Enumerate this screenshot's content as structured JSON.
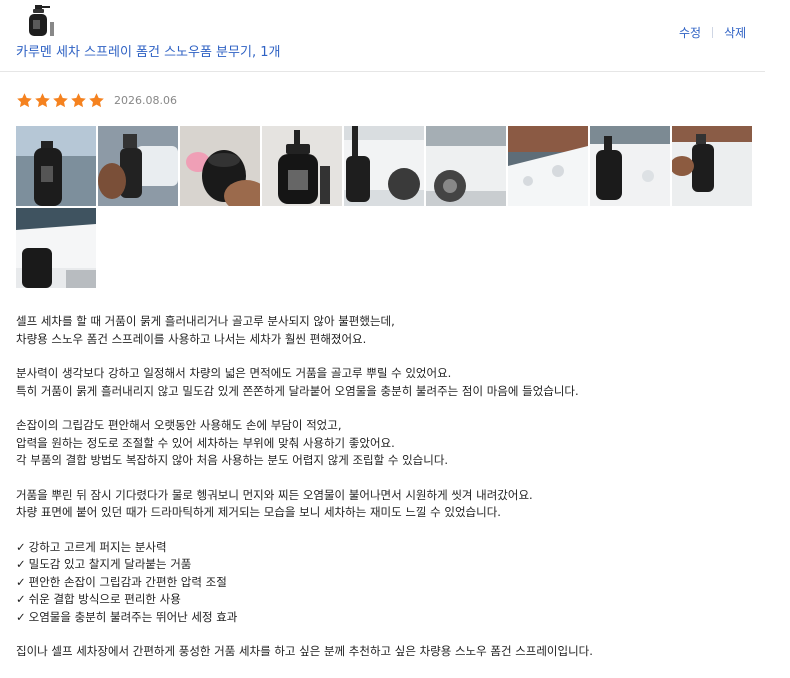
{
  "product": {
    "title": "카루멘 세차 스프레이 폼건 스노우폼 분무기, 1개",
    "thumbnail_icon": "foam-sprayer-bottle"
  },
  "actions": {
    "edit_label": "수정",
    "delete_label": "삭제"
  },
  "review": {
    "rating": 5,
    "max_rating": 5,
    "date": "2026.08.06",
    "photo_count": 10,
    "paragraphs": [
      {
        "lines": [
          "셀프 세차를 할 때 거품이 묽게 흘러내리거나 골고루 분사되지 않아 불편했는데,",
          "차량용 스노우 폼건 스프레이를 사용하고 나서는 세차가 훨씬 편해졌어요."
        ]
      },
      {
        "lines": [
          "분사력이 생각보다 강하고 일정해서 차량의 넓은 면적에도 거품을 골고루 뿌릴 수 있었어요.",
          "특히 거품이 묽게 흘러내리지 않고 밀도감 있게 쫀쫀하게 달라붙어 오염물을 충분히 불려주는 점이 마음에 들었습니다."
        ]
      },
      {
        "lines": [
          "손잡이의 그립감도 편안해서 오랫동안 사용해도 손에 부담이 적었고,",
          "압력을 원하는 정도로 조절할 수 있어 세차하는 부위에 맞춰 사용하기 좋았어요.",
          "각 부품의 결합 방법도 복잡하지 않아 처음 사용하는 분도 어렵지 않게 조립할 수 있습니다."
        ]
      },
      {
        "lines": [
          "거품을 뿌린 뒤 잠시 기다렸다가 물로 헹궈보니 먼지와 찌든 오염물이 불어나면서 시원하게 씻겨 내려갔어요.",
          "차량 표면에 붙어 있던 때가 드라마틱하게 제거되는 모습을 보니 세차하는 재미도 느낄 수 있었습니다."
        ]
      }
    ],
    "check_mark": "✓",
    "checklist": [
      "강하고 고르게 퍼지는 분사력",
      "밀도감 있고 찰지게 달라붙는 거품",
      "편안한 손잡이 그립감과 간편한 압력 조절",
      "쉬운 결합 방식으로 편리한 사용",
      "오염물을 충분히 불려주는 뛰어난 세정 효과"
    ],
    "closing": "집이나 셀프 세차장에서 간편하게 풍성한 거품 세차를 하고 싶은 분께 추천하고 싶은 차량용 스노우 폼건 스프레이입니다."
  },
  "colors": {
    "link": "#2f62c4",
    "star": "#f5821f",
    "date": "#888888",
    "divider": "#e6e6e6"
  }
}
